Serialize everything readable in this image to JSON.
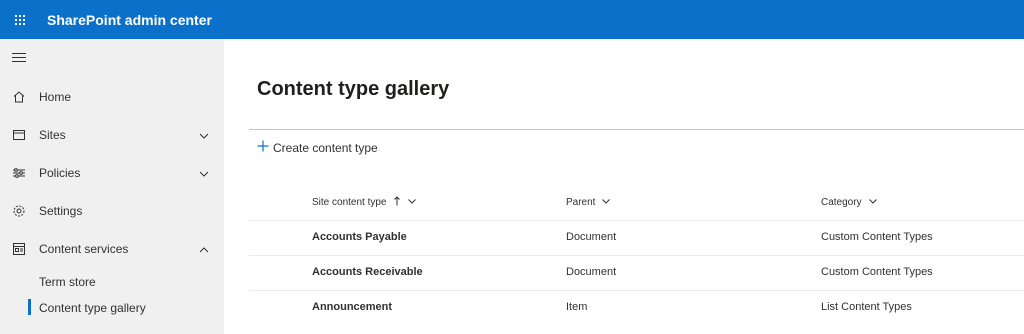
{
  "app": {
    "title": "SharePoint admin center"
  },
  "nav": {
    "items": [
      {
        "label": "Home",
        "icon": "home-icon"
      },
      {
        "label": "Sites",
        "icon": "sites-icon"
      },
      {
        "label": "Policies",
        "icon": "policies-icon"
      },
      {
        "label": "Settings",
        "icon": "gear-icon"
      },
      {
        "label": "Content services",
        "icon": "content-services-icon"
      }
    ],
    "sub_items": [
      {
        "label": "Term store"
      },
      {
        "label": "Content type gallery",
        "selected": true
      }
    ]
  },
  "main": {
    "title": "Content type gallery",
    "command": {
      "label": "Create content type",
      "icon": "plus-icon"
    },
    "columns": [
      {
        "label": "Site content type",
        "sorted": "ascending"
      },
      {
        "label": "Parent"
      },
      {
        "label": "Category"
      }
    ],
    "rows": [
      {
        "name": "Accounts Payable",
        "parent": "Document",
        "category": "Custom Content Types"
      },
      {
        "name": "Accounts Receivable",
        "parent": "Document",
        "category": "Custom Content Types"
      },
      {
        "name": "Announcement",
        "parent": "Item",
        "category": "List Content Types"
      }
    ]
  },
  "colors": {
    "accent": "#0a70c9",
    "sidebar_bg": "#f0f0f0"
  }
}
